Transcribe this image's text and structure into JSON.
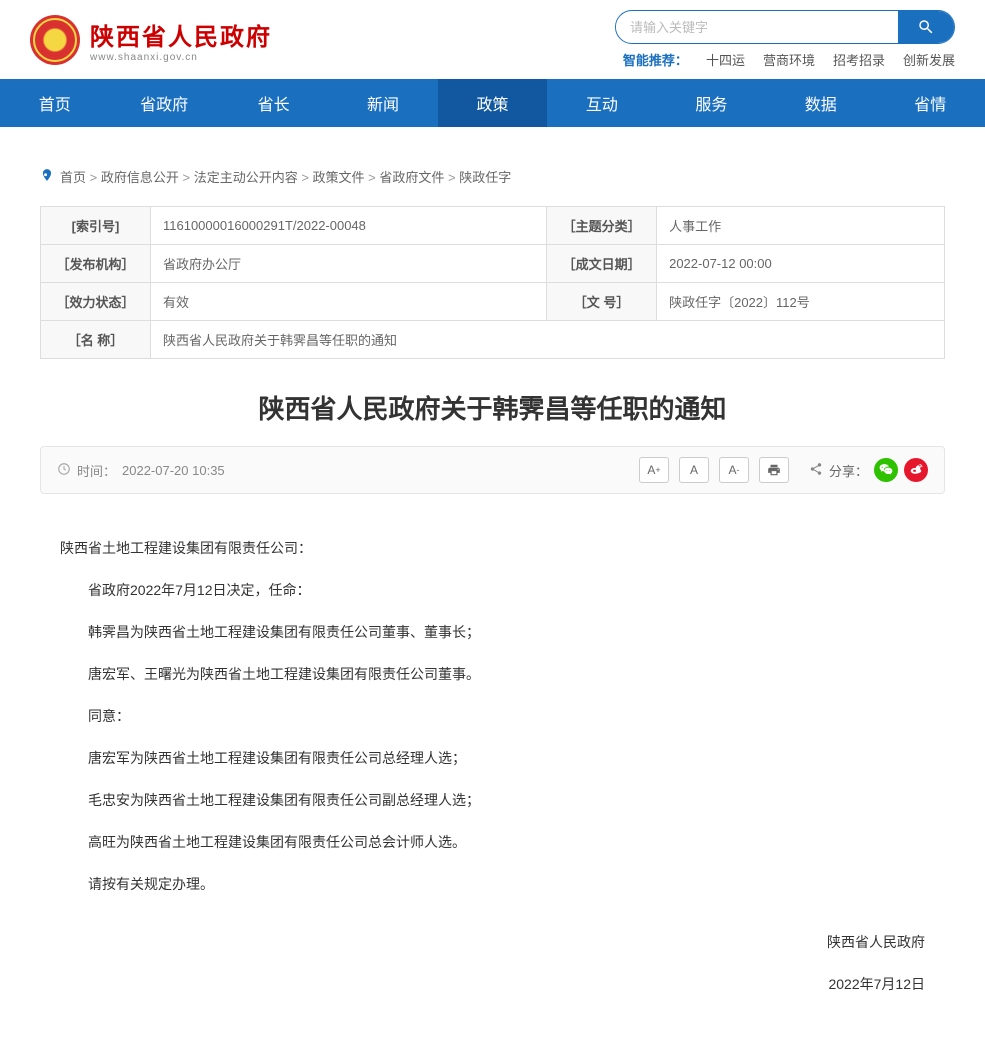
{
  "site": {
    "title": "陕西省人民政府",
    "url": "www.shaanxi.gov.cn"
  },
  "search": {
    "placeholder": "请输入关键字"
  },
  "recommend": {
    "label": "智能推荐：",
    "items": [
      "十四运",
      "营商环境",
      "招考招录",
      "创新发展"
    ]
  },
  "nav": {
    "items": [
      "首页",
      "省政府",
      "省长",
      "新闻",
      "政策",
      "互动",
      "服务",
      "数据",
      "省情"
    ],
    "active_index": 4
  },
  "breadcrumb": {
    "items": [
      "首页",
      "政府信息公开",
      "法定主动公开内容",
      "政策文件",
      "省政府文件",
      "陕政任字"
    ]
  },
  "meta": {
    "index_label": "[索引号]",
    "index_value": "11610000016000291T/2022-00048",
    "subject_label": "［主题分类］",
    "subject_value": "人事工作",
    "publisher_label": "［发布机构］",
    "publisher_value": "省政府办公厅",
    "date_label": "［成文日期］",
    "date_value": "2022-07-12 00:00",
    "status_label": "［效力状态］",
    "status_value": "有效",
    "docnum_label": "［文 号］",
    "docnum_value": "陕政任字〔2022〕112号",
    "name_label": "［名 称］",
    "name_value": "陕西省人民政府关于韩霁昌等任职的通知"
  },
  "article": {
    "title": "陕西省人民政府关于韩霁昌等任职的通知",
    "time_label": "时间：",
    "time_value": "2022-07-20 10:35",
    "share_label": "分享：",
    "body": [
      "陕西省土地工程建设集团有限责任公司：",
      "省政府2022年7月12日决定，任命：",
      "韩霁昌为陕西省土地工程建设集团有限责任公司董事、董事长；",
      "唐宏军、王曙光为陕西省土地工程建设集团有限责任公司董事。",
      "同意：",
      "唐宏军为陕西省土地工程建设集团有限责任公司总经理人选；",
      "毛忠安为陕西省土地工程建设集团有限责任公司副总经理人选；",
      "高旺为陕西省土地工程建设集团有限责任公司总会计师人选。",
      "请按有关规定办理。"
    ],
    "signature": "陕西省人民政府",
    "sign_date": "2022年7月12日"
  }
}
